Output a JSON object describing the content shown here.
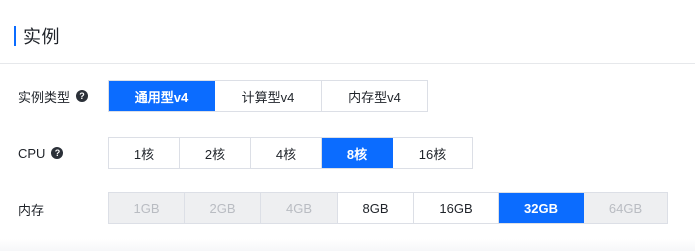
{
  "section": {
    "title": "实例"
  },
  "instance_type": {
    "label": "实例类型",
    "help": "?",
    "options": [
      {
        "label": "通用型v4",
        "state": "selected"
      },
      {
        "label": "计算型v4",
        "state": "normal"
      },
      {
        "label": "内存型v4",
        "state": "normal"
      }
    ]
  },
  "cpu": {
    "label": "CPU",
    "help": "?",
    "options": [
      {
        "label": "1核",
        "state": "normal"
      },
      {
        "label": "2核",
        "state": "normal"
      },
      {
        "label": "4核",
        "state": "normal"
      },
      {
        "label": "8核",
        "state": "selected"
      },
      {
        "label": "16核",
        "state": "normal"
      }
    ]
  },
  "memory": {
    "label": "内存",
    "options": [
      {
        "label": "1GB",
        "state": "disabled"
      },
      {
        "label": "2GB",
        "state": "disabled"
      },
      {
        "label": "4GB",
        "state": "disabled"
      },
      {
        "label": "8GB",
        "state": "normal"
      },
      {
        "label": "16GB",
        "state": "normal"
      },
      {
        "label": "32GB",
        "state": "selected"
      },
      {
        "label": "64GB",
        "state": "disabled"
      }
    ]
  },
  "colors": {
    "accent": "#0b6cff",
    "disabled_bg": "#eeeff1",
    "disabled_text": "#b9bcc2",
    "border": "#dcdfe6"
  }
}
